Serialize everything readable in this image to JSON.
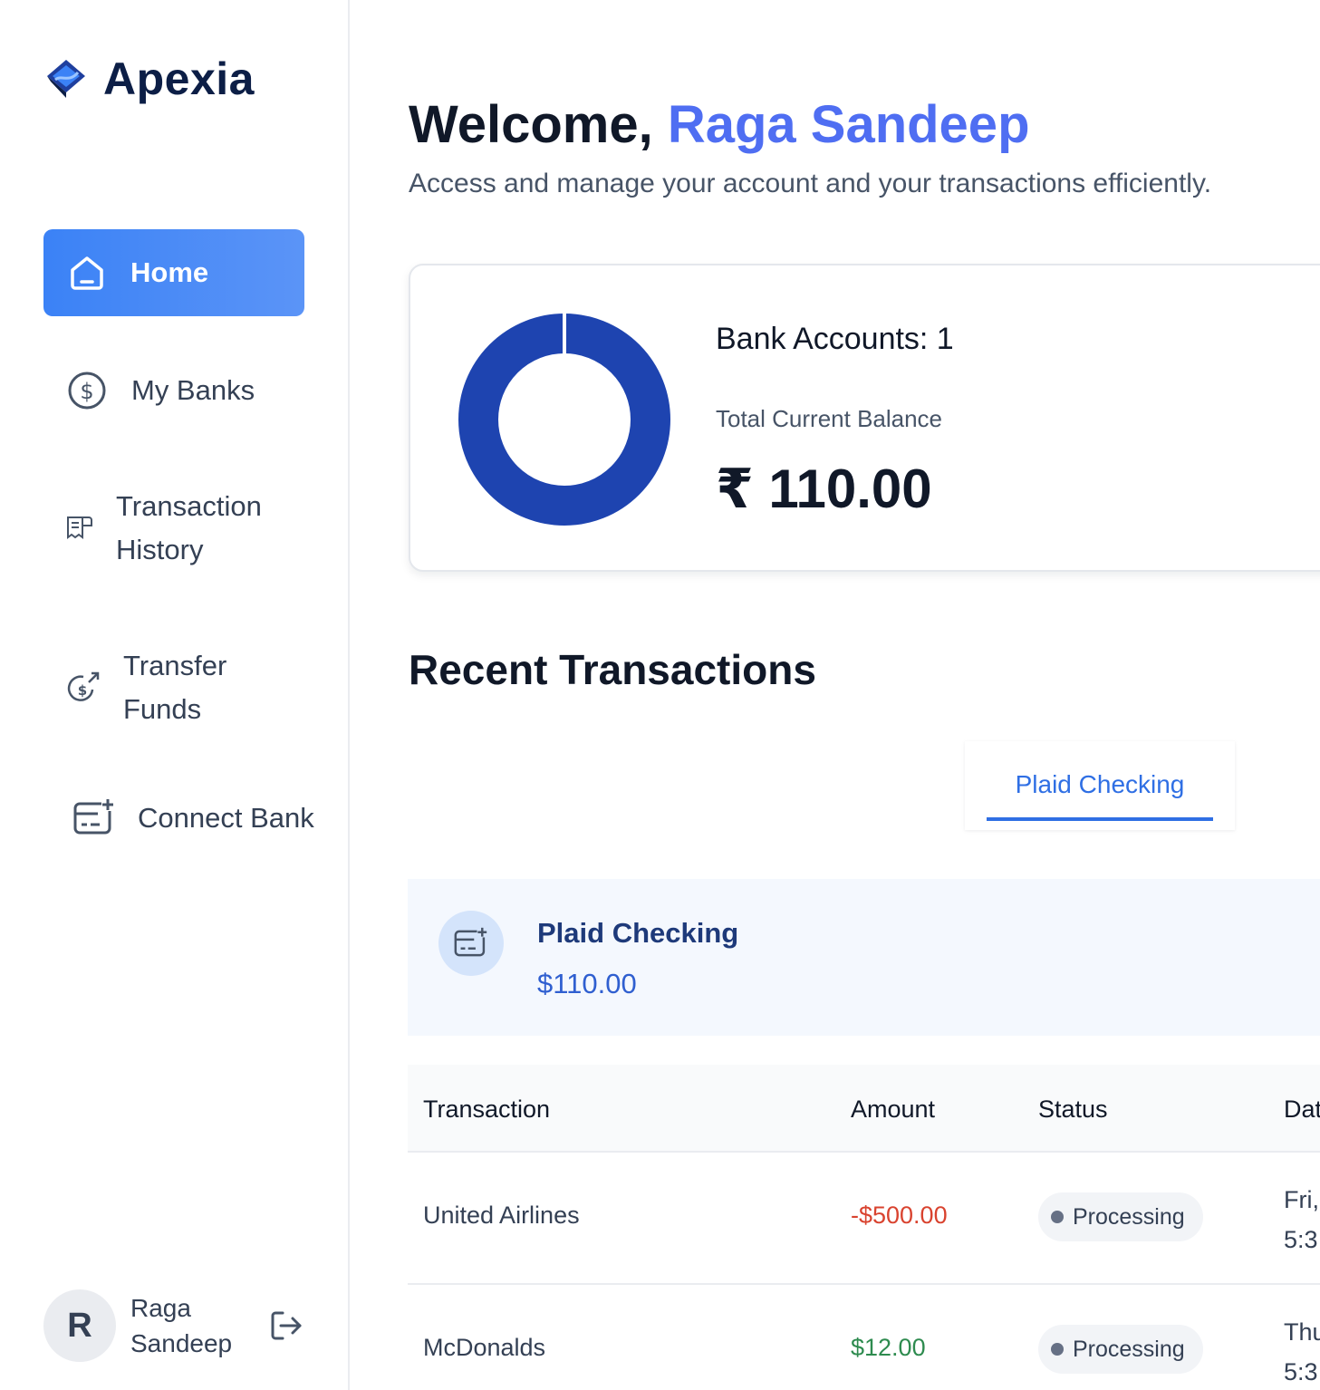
{
  "brand": {
    "name": "Apexia"
  },
  "sidebar": {
    "items": [
      {
        "label": "Home",
        "icon": "home-icon",
        "active": true
      },
      {
        "label": "My Banks",
        "icon": "dollar-circle-icon"
      },
      {
        "label_line1": "Transaction",
        "label_line2": "History",
        "icon": "receipt-icon"
      },
      {
        "label_line1": "Transfer",
        "label_line2": "Funds",
        "icon": "money-send-icon"
      },
      {
        "label": "Connect Bank",
        "icon": "card-add-icon"
      }
    ],
    "user": {
      "initial": "R",
      "name_line1": "Raga",
      "name_line2": "Sandeep"
    }
  },
  "header": {
    "greeting": "Welcome, ",
    "user_name": "Raga Sandeep",
    "subtitle": "Access and manage your account and your transactions efficiently."
  },
  "balance": {
    "bank_accounts": "Bank Accounts: 1",
    "label": "Total Current Balance",
    "amount": "₹ 110.00",
    "donut_color": "#1e44b0"
  },
  "recent": {
    "title": "Recent Transactions",
    "tabs": [
      {
        "label": "Plaid Checking",
        "active": true
      }
    ],
    "account": {
      "name": "Plaid Checking",
      "balance": "$110.00"
    },
    "columns": [
      "Transaction",
      "Amount",
      "Status",
      "Dat"
    ],
    "transactions": [
      {
        "name": "United Airlines",
        "amount": "-$500.00",
        "status": "Processing",
        "date_line1": "Fri,",
        "date_line2": "5:3"
      },
      {
        "name": "McDonalds",
        "amount": "$12.00",
        "status": "Processing",
        "date_line1": "Thu",
        "date_line2": "5:3"
      }
    ]
  },
  "colors": {
    "accent": "#3b82f6",
    "name_accent": "#4f6ef2",
    "negative": "#d9432f",
    "positive": "#2e8b4f"
  }
}
